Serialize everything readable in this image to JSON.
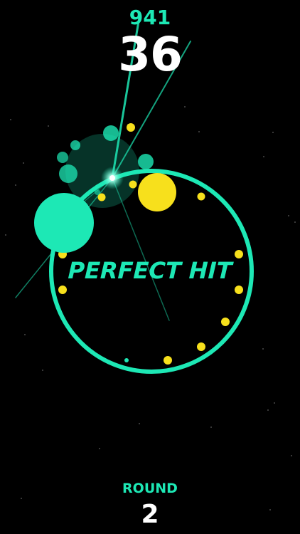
{
  "hud": {
    "best_score": "941",
    "score": "36",
    "message": "PERFECT HIT",
    "round_label": "ROUND",
    "round_number": "2"
  },
  "colors": {
    "background": "#000000",
    "accent": "#1de8b5",
    "pellet": "#f7e01c",
    "text": "#ffffff"
  },
  "game": {
    "player_ball": "teal-ball",
    "target_ball": "yellow-ball",
    "orbit_pellets_remaining": 11
  }
}
